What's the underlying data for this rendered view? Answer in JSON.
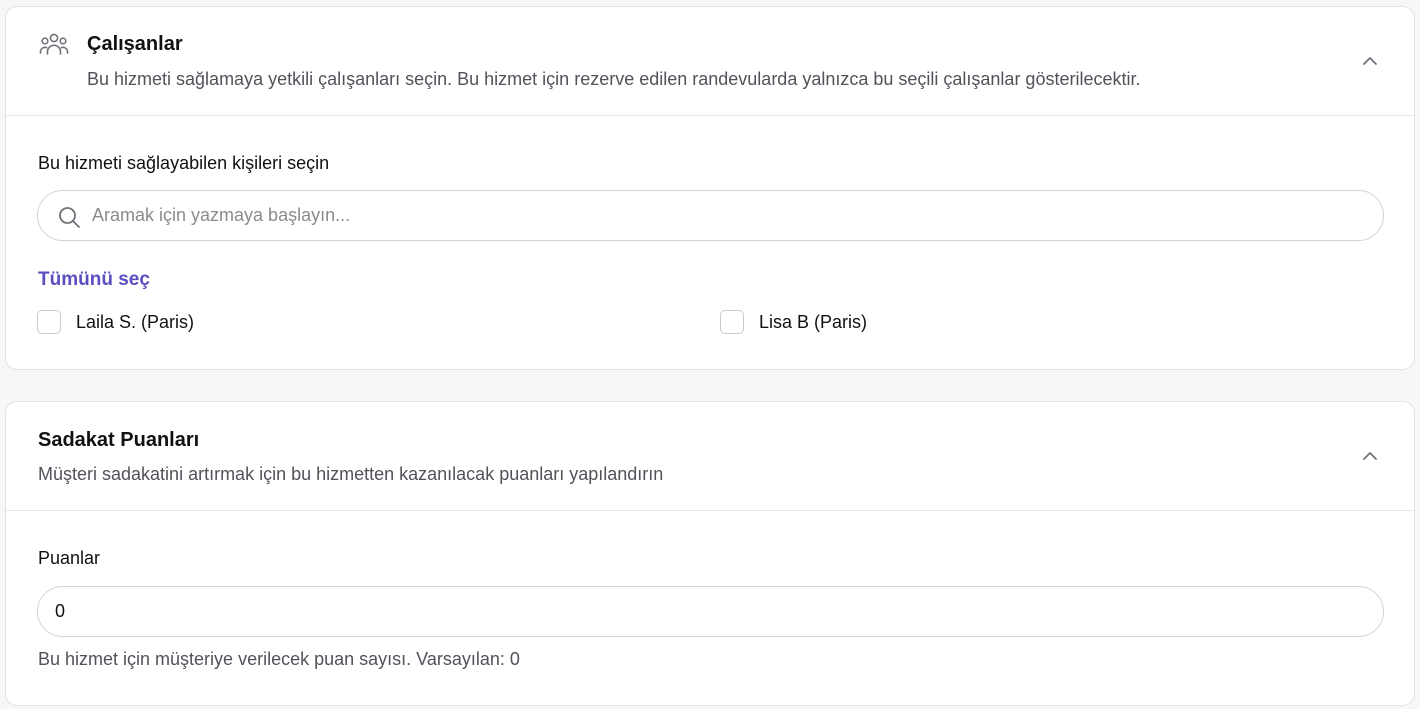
{
  "employees_section": {
    "title": "Çalışanlar",
    "subtitle": "Bu hizmeti sağlamaya yetkili çalışanları seçin. Bu hizmet için rezerve edilen randevularda yalnızca bu seçili çalışanlar gösterilecektir.",
    "icon": "people-group-icon",
    "field_label": "Bu hizmeti sağlayabilen kişileri seçin",
    "search": {
      "placeholder": "Aramak için yazmaya başlayın...",
      "value": ""
    },
    "select_all_label": "Tümünü seç",
    "employees": [
      {
        "name": "Laila S. (Paris)",
        "checked": false
      },
      {
        "name": "Lisa B (Paris)",
        "checked": false
      }
    ]
  },
  "loyalty_section": {
    "title": "Sadakat Puanları",
    "subtitle": "Müşteri sadakatini artırmak için bu hizmetten kazanılacak puanları yapılandırın",
    "field_label": "Puanlar",
    "points_value": "0",
    "helper_text": "Bu hizmet için müşteriye verilecek puan sayısı. Varsayılan: 0"
  },
  "colors": {
    "accent": "#5b4fc0",
    "background": "#f7f7f7",
    "card": "#ffffff",
    "border": "#e4e4e7",
    "muted_text": "#52525b"
  }
}
